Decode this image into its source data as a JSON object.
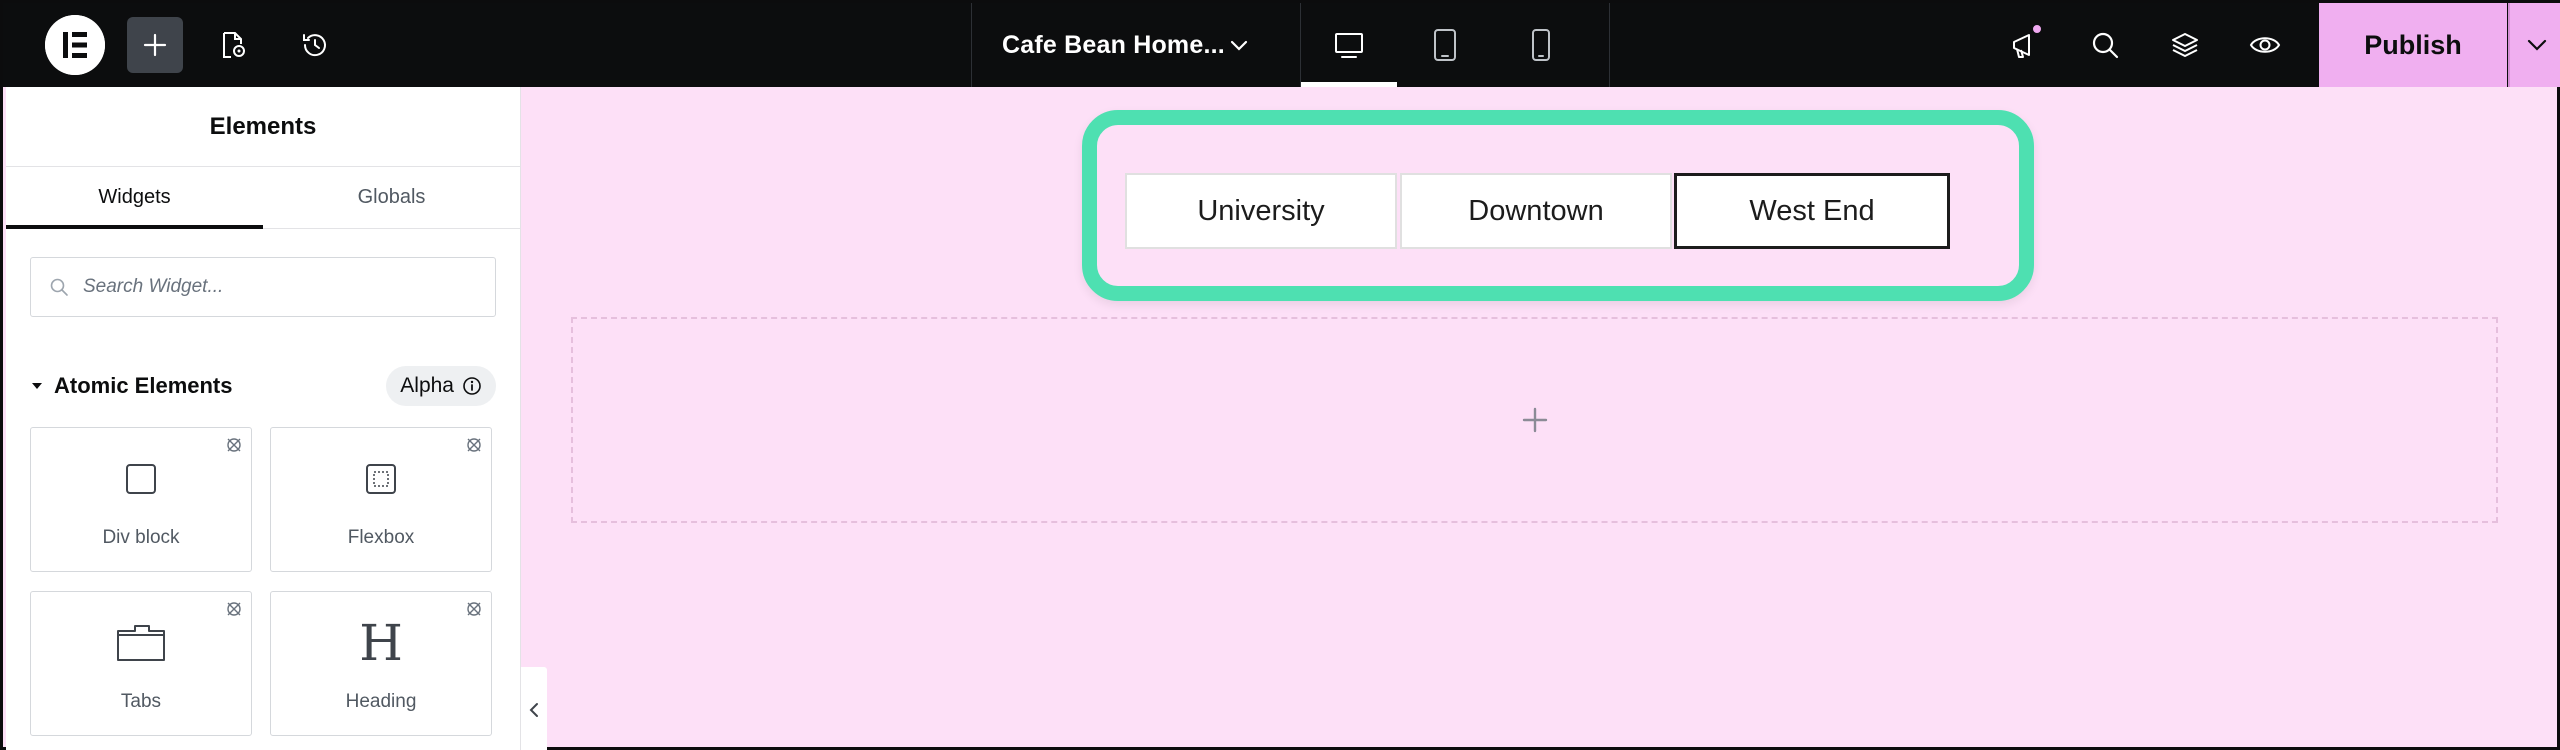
{
  "topbar": {
    "document_title": "Cafe Bean Home...",
    "publish_label": "Publish"
  },
  "panel": {
    "title": "Elements",
    "tabs": [
      {
        "label": "Widgets",
        "active": true
      },
      {
        "label": "Globals",
        "active": false
      }
    ],
    "search": {
      "placeholder": "Search Widget..."
    },
    "category": {
      "title": "Atomic Elements",
      "badge": "Alpha"
    },
    "widgets": [
      {
        "label": "Div block",
        "icon": "div-block-icon"
      },
      {
        "label": "Flexbox",
        "icon": "flexbox-icon"
      },
      {
        "label": "Tabs",
        "icon": "tabs-icon"
      },
      {
        "label": "Heading",
        "icon": "heading-icon",
        "glyph": "H"
      }
    ]
  },
  "canvas": {
    "location_tabs": [
      {
        "label": "University",
        "active": false
      },
      {
        "label": "Downtown",
        "active": false
      },
      {
        "label": "West End",
        "active": true
      }
    ],
    "add_symbol": "+"
  },
  "colors": {
    "topbar_bg": "#0c0d0e",
    "publish_bg": "#f0aff0",
    "canvas_bg": "#fde0f7",
    "highlight": "#4ee0b1"
  }
}
